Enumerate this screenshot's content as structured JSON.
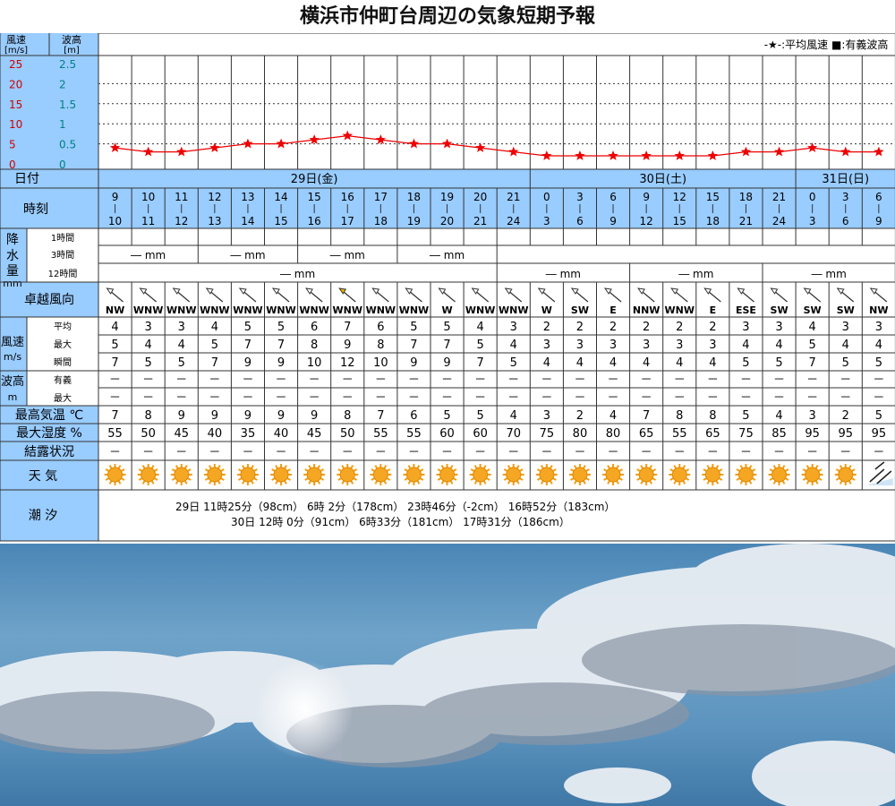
{
  "title": "横浜市仲町台周辺の気象短期予報",
  "legend": {
    "wind": "-★-:平均風速",
    "wave": "■:有義波高"
  },
  "units": {
    "wind_header": "風速",
    "wind_unit": "[m/s]",
    "wave_header": "波高",
    "wave_unit": "[m]"
  },
  "chart_data": {
    "type": "line",
    "ylabel_left": "風速 [m/s]",
    "ylabel_right": "波高 [m]",
    "ylim": [
      0,
      25
    ],
    "ylim_right": [
      0,
      2.5
    ],
    "y_ticks": [
      "0",
      "5",
      "10",
      "15",
      "20",
      "25"
    ],
    "y2_ticks": [
      "0",
      "0.5",
      "1",
      "1.5",
      "2",
      "2.5"
    ],
    "grid": true,
    "legend_position": "top-right",
    "x": [
      "9-10",
      "10-11",
      "11-12",
      "12-13",
      "13-14",
      "14-15",
      "15-16",
      "16-17",
      "17-18",
      "18-19",
      "19-20",
      "20-21",
      "21-24",
      "0-3",
      "3-6",
      "6-9",
      "9-12",
      "12-15",
      "15-18",
      "18-21",
      "21-24",
      "0-3",
      "3-6",
      "6-9"
    ],
    "series": [
      {
        "name": "平均風速",
        "color": "#ee0000",
        "values": [
          4,
          3,
          3,
          4,
          5,
          5,
          6,
          7,
          6,
          5,
          5,
          4,
          3,
          2,
          2,
          2,
          2,
          2,
          2,
          3,
          3,
          4,
          3,
          3
        ]
      }
    ]
  },
  "days": [
    {
      "label": "日付",
      "d1": "29日(金)",
      "d2": "30日(土)",
      "d3": "31日(日)"
    }
  ],
  "labels": {
    "date": "日付",
    "time": "時刻",
    "precip": "降水量mm",
    "precip_1h": "1時間",
    "precip_3h": "3時間",
    "precip_12h": "12時間",
    "dir": "卓越風向",
    "wind": "風速m/s",
    "wind_avg": "平均",
    "wind_max": "最大",
    "wind_gust": "瞬間",
    "wave": "波高m",
    "wave_sig": "有義",
    "wave_max": "最大",
    "temp": "最高気温 ℃",
    "humid": "最大湿度 %",
    "dew": "結露状況",
    "weather": "天 気",
    "tide": "潮 汐"
  },
  "times_top": [
    "9",
    "10",
    "11",
    "12",
    "13",
    "14",
    "15",
    "16",
    "17",
    "18",
    "19",
    "20",
    "21",
    "0",
    "3",
    "6",
    "9",
    "12",
    "15",
    "18",
    "21",
    "0",
    "3",
    "6"
  ],
  "times_bottom": [
    "10",
    "11",
    "12",
    "13",
    "14",
    "15",
    "16",
    "17",
    "18",
    "19",
    "20",
    "21",
    "24",
    "3",
    "6",
    "9",
    "12",
    "15",
    "18",
    "21",
    "24",
    "3",
    "6",
    "9"
  ],
  "precip_3h": [
    "― mm",
    "― mm",
    "― mm",
    "― mm"
  ],
  "precip_12h": [
    "― mm",
    "― mm",
    "― mm",
    "― mm"
  ],
  "directions": [
    "NW",
    "WNW",
    "WNW",
    "WNW",
    "WNW",
    "WNW",
    "WNW",
    "WNW",
    "WNW",
    "WNW",
    "W",
    "WNW",
    "WNW",
    "W",
    "SW",
    "E",
    "NNW",
    "WNW",
    "E",
    "ESE",
    "SW",
    "SW",
    "SW",
    "NW"
  ],
  "wind_avg": [
    "4",
    "3",
    "3",
    "4",
    "5",
    "5",
    "6",
    "7",
    "6",
    "5",
    "5",
    "4",
    "3",
    "2",
    "2",
    "2",
    "2",
    "2",
    "2",
    "3",
    "3",
    "4",
    "3",
    "3"
  ],
  "wind_max": [
    "5",
    "4",
    "4",
    "5",
    "7",
    "7",
    "8",
    "9",
    "8",
    "7",
    "7",
    "5",
    "4",
    "3",
    "3",
    "3",
    "3",
    "3",
    "3",
    "4",
    "4",
    "5",
    "4",
    "4"
  ],
  "wind_gust": [
    "7",
    "5",
    "5",
    "7",
    "9",
    "9",
    "10",
    "12",
    "10",
    "9",
    "9",
    "7",
    "5",
    "4",
    "4",
    "4",
    "4",
    "4",
    "4",
    "5",
    "5",
    "7",
    "5",
    "5"
  ],
  "wave_sig": [
    "－",
    "－",
    "－",
    "－",
    "－",
    "－",
    "－",
    "－",
    "－",
    "－",
    "－",
    "－",
    "－",
    "－",
    "－",
    "－",
    "－",
    "－",
    "－",
    "－",
    "－",
    "－",
    "－",
    "－"
  ],
  "wave_max": [
    "－",
    "－",
    "－",
    "－",
    "－",
    "－",
    "－",
    "－",
    "－",
    "－",
    "－",
    "－",
    "－",
    "－",
    "－",
    "－",
    "－",
    "－",
    "－",
    "－",
    "－",
    "－",
    "－",
    "－"
  ],
  "temp": [
    "7",
    "8",
    "9",
    "9",
    "9",
    "9",
    "9",
    "8",
    "7",
    "6",
    "5",
    "5",
    "4",
    "3",
    "2",
    "4",
    "7",
    "8",
    "8",
    "5",
    "4",
    "3",
    "2",
    "5"
  ],
  "humid": [
    "55",
    "50",
    "45",
    "40",
    "35",
    "40",
    "45",
    "50",
    "55",
    "55",
    "60",
    "60",
    "70",
    "75",
    "80",
    "80",
    "65",
    "55",
    "65",
    "75",
    "85",
    "95",
    "95",
    "95"
  ],
  "dew": [
    "－",
    "－",
    "－",
    "－",
    "－",
    "－",
    "－",
    "－",
    "－",
    "－",
    "－",
    "－",
    "－",
    "－",
    "－",
    "－",
    "－",
    "－",
    "－",
    "－",
    "－",
    "－",
    "－",
    "－"
  ],
  "weather": [
    "sunny-icon",
    "sunny-icon",
    "sunny-icon",
    "sunny-icon",
    "sunny-icon",
    "sunny-icon",
    "sunny-icon",
    "sunny-icon",
    "sunny-icon",
    "sunny-icon",
    "sunny-icon",
    "sunny-icon",
    "sunny-icon",
    "sunny-icon",
    "sunny-icon",
    "sunny-icon",
    "sunny-icon",
    "sunny-icon",
    "sunny-icon",
    "sunny-icon",
    "sunny-icon",
    "sunny-icon",
    "sunny-icon",
    "cloudy-rain-icon"
  ],
  "tide": {
    "line1": "29日 11時25分（98cm） 6時 2分（178cm） 23時46分（-2cm） 16時52分（183cm）",
    "line2": "30日 12時 0分（91cm） 6時33分（181cm） 17時31分（186cm）"
  }
}
